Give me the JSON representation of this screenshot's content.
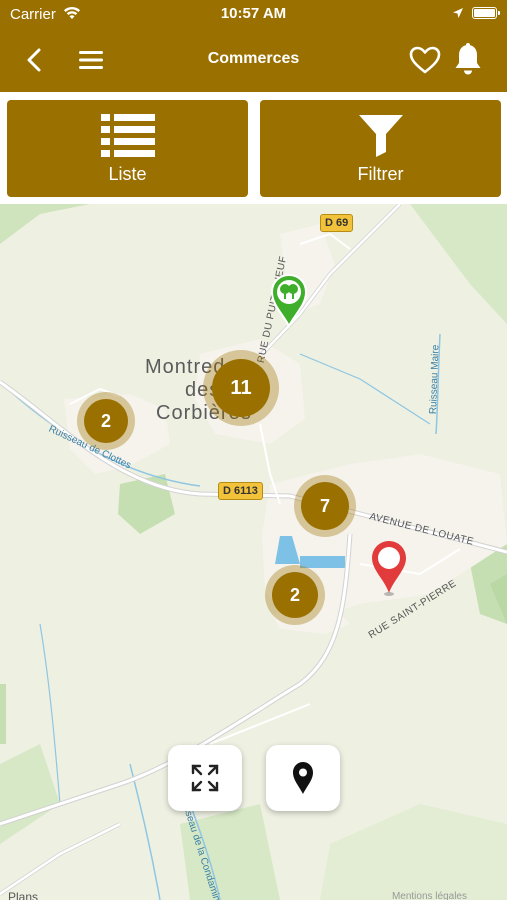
{
  "status_bar": {
    "carrier": "Carrier",
    "time": "10:57 AM"
  },
  "nav": {
    "title": "Commerces",
    "back_icon": "chevron-left-icon",
    "menu_icon": "hamburger-menu-icon",
    "favorites_icon": "heart-icon",
    "notifications_icon": "bell-icon"
  },
  "actions": {
    "list_label": "Liste",
    "filter_label": "Filtrer"
  },
  "map": {
    "town_line1": "Montredon-",
    "town_line2": "des-",
    "town_line3": "Corbières",
    "roads": [
      "D 69",
      "D 6113"
    ],
    "streets": {
      "avenue_louate": "AVENUE DE LOUATE",
      "rue_saint_pierre": "RUE SAINT-PIERRE",
      "rue_du_puits_neuf": "RUE DU PUITS NEUF"
    },
    "waterways": {
      "ruisseau_clottes": "Ruisseau de Clottes",
      "ruisseau_maire": "Ruisseau Maire",
      "ruisseau_condamine": "Ruisseau de la Condamine"
    },
    "clusters": [
      {
        "count": "11"
      },
      {
        "count": "2"
      },
      {
        "count": "7"
      },
      {
        "count": "2"
      }
    ],
    "legal_text": "Plans",
    "legal_right": "Mentions légales"
  },
  "colors": {
    "brand": "#9a7000",
    "map_background": "#eef0e2",
    "selected_pin": "#e23b3b",
    "category_pin": "#3fae2a"
  }
}
